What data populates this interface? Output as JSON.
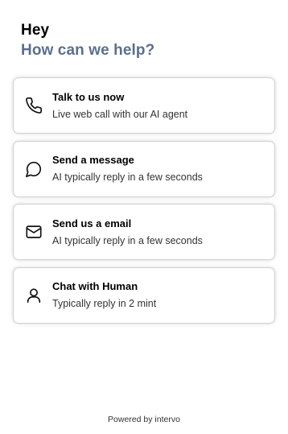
{
  "header": {
    "greeting": "Hey",
    "subheading": "How can we help?"
  },
  "options": [
    {
      "icon": "phone-icon",
      "title": "Talk to us now",
      "description": "Live web call with our AI agent"
    },
    {
      "icon": "chat-bubble-icon",
      "title": "Send a message",
      "description": "AI typically reply in a few seconds"
    },
    {
      "icon": "mail-icon",
      "title": "Send us a email",
      "description": "AI typically reply in a few seconds"
    },
    {
      "icon": "user-icon",
      "title": "Chat with Human",
      "description": "Typically reply in 2 mint"
    }
  ],
  "footer": {
    "text": "Powered by intervo"
  },
  "colors": {
    "subheading": "#5b6f8c",
    "card_border": "#cfcfcf"
  }
}
